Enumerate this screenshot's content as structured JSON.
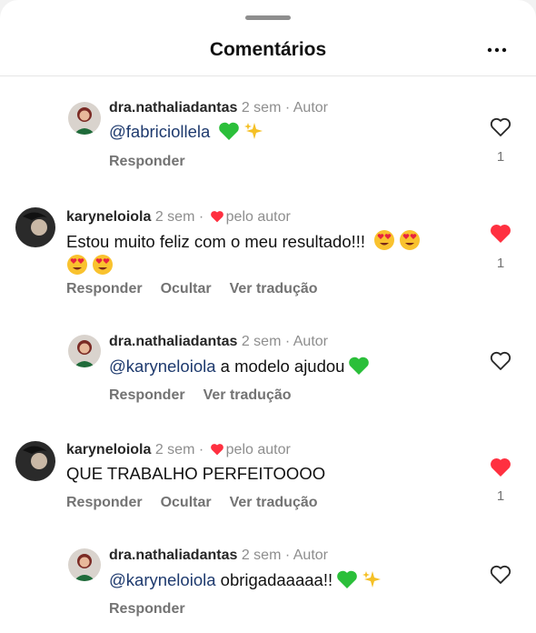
{
  "header": {
    "title": "Comentários",
    "more_icon": "more-horizontal-icon"
  },
  "colors": {
    "like_red": "#ff3040",
    "green_heart": "#2bbf3a",
    "sparkle": "#f5c026",
    "mention": "#1e3a6e"
  },
  "comments": [
    {
      "username": "dra.nathaliadantas",
      "time": "2 sem",
      "tag": "· Autor",
      "mention": "@fabriciollela",
      "text": "",
      "emojis": [
        "green-heart",
        "sparkles"
      ],
      "actions": [
        "Responder"
      ],
      "liked": false,
      "likes": "1"
    },
    {
      "username": "karyneloiola",
      "time": "2 sem",
      "tag": "· ",
      "liked_by": "pelo autor",
      "mention": "",
      "text": "Estou muito feliz com o meu resultado!!!",
      "emojis": [
        "heart-eyes",
        "heart-eyes",
        "heart-eyes",
        "heart-eyes"
      ],
      "actions": [
        "Responder",
        "Ocultar",
        "Ver tradução"
      ],
      "liked": true,
      "likes": "1"
    },
    {
      "username": "dra.nathaliadantas",
      "time": "2 sem",
      "tag": "· Autor",
      "mention": "@karyneloiola",
      "text": "a modelo ajudou",
      "emojis": [
        "green-heart"
      ],
      "actions": [
        "Responder",
        "Ver tradução"
      ],
      "liked": false,
      "likes": ""
    },
    {
      "username": "karyneloiola",
      "time": "2 sem",
      "tag": "· ",
      "liked_by": "pelo autor",
      "mention": "",
      "text": "QUE TRABALHO PERFEITOOOO",
      "emojis": [],
      "actions": [
        "Responder",
        "Ocultar",
        "Ver tradução"
      ],
      "liked": true,
      "likes": "1"
    },
    {
      "username": "dra.nathaliadantas",
      "time": "2 sem",
      "tag": "· Autor",
      "mention": "@karyneloiola",
      "text": "obrigadaaaaa!!",
      "emojis": [
        "green-heart",
        "sparkles"
      ],
      "actions": [
        "Responder"
      ],
      "liked": false,
      "likes": ""
    }
  ]
}
